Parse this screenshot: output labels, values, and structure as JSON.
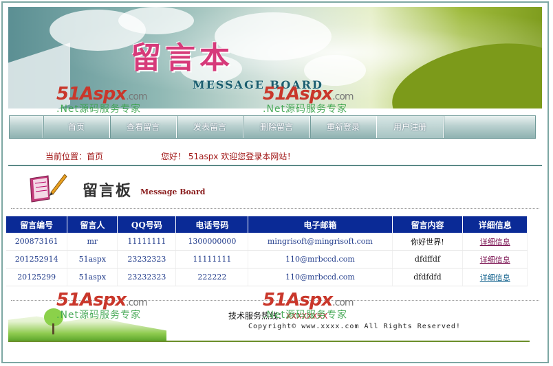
{
  "banner": {
    "title": "留言本",
    "subtitle": "MESSAGE BOARD"
  },
  "watermark": {
    "logo": "51Aspx",
    "domain": ".com",
    "tagline": ".Net源码服务专家"
  },
  "nav": {
    "items": [
      {
        "label": "首页"
      },
      {
        "label": "查看留言"
      },
      {
        "label": "发表留言"
      },
      {
        "label": "删除留言"
      },
      {
        "label": "重新登录"
      },
      {
        "label": "用户注册",
        "active": true
      }
    ]
  },
  "location": {
    "text": "当前位置：首页",
    "welcome": "您好！ 51aspx 欢迎您登录本网站！"
  },
  "board": {
    "title": "留言板",
    "subtitle": "Message Board"
  },
  "table": {
    "headers": [
      "留言编号",
      "留言人",
      "QQ号码",
      "电话号码",
      "电子邮箱",
      "留言内容",
      "详细信息"
    ],
    "rows": [
      {
        "id": "200873161",
        "author": "mr",
        "qq": "11111111",
        "phone": "1300000000",
        "email": "mingrisoft@mingrisoft.com",
        "content": "你好世界!",
        "detail": "详细信息"
      },
      {
        "id": "201252914",
        "author": "51aspx",
        "qq": "23232323",
        "phone": "11111111",
        "email": "110@mrbccd.com",
        "content": "dfdffdf",
        "detail": "详细信息"
      },
      {
        "id": "20125299",
        "author": "51aspx",
        "qq": "23232323",
        "phone": "222222",
        "email": "110@mrbccd.com",
        "content": "dfdfdfd",
        "detail": "详细信息"
      }
    ]
  },
  "footer": {
    "hotline_label": "技术服务热线：",
    "hotline_number": "XXXXXXXX",
    "copyright": "Copyright© www.xxxx.com  All Rights Reserved!"
  },
  "colors": {
    "table_header_bg": "#0a2a96",
    "nav_bg": "#8fb2b1",
    "accent_red": "#a01515"
  }
}
